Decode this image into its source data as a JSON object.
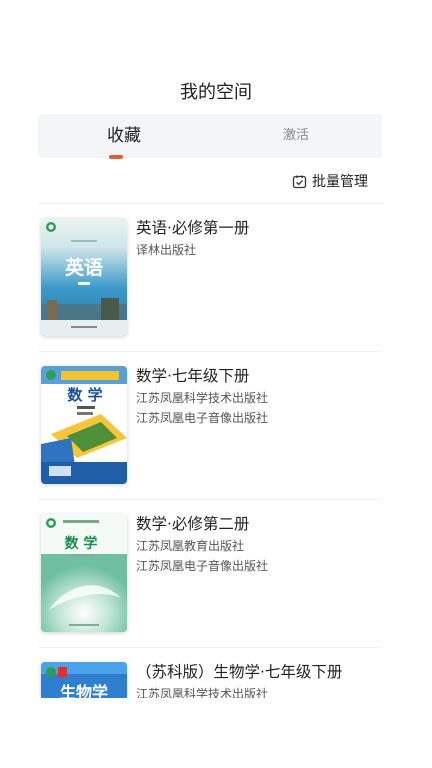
{
  "header": {
    "title": "我的空间"
  },
  "tabs": [
    {
      "label": "收藏",
      "active": true
    },
    {
      "label": "激活",
      "active": false
    }
  ],
  "actions": {
    "batch_label": "批量管理",
    "batch_icon": "checklist-icon"
  },
  "colors": {
    "accent": "#e8593a",
    "tab_bg": "#f4f5f7"
  },
  "books": [
    {
      "title": "英语·必修第一册",
      "publishers": [
        "译林出版社"
      ],
      "cover_label": "英语"
    },
    {
      "title": "数学·七年级下册",
      "publishers": [
        "江苏凤凰科学技术出版社",
        "江苏凤凰电子音像出版社"
      ],
      "cover_label": "数 学"
    },
    {
      "title": "数学·必修第二册",
      "publishers": [
        "江苏凤凰教育出版社",
        "江苏凤凰电子音像出版社"
      ],
      "cover_label": "数 学"
    },
    {
      "title": "（苏科版）生物学·七年级下册",
      "publishers": [
        "江苏凤凰科学技术出版社"
      ],
      "cover_label": "生物学"
    }
  ]
}
